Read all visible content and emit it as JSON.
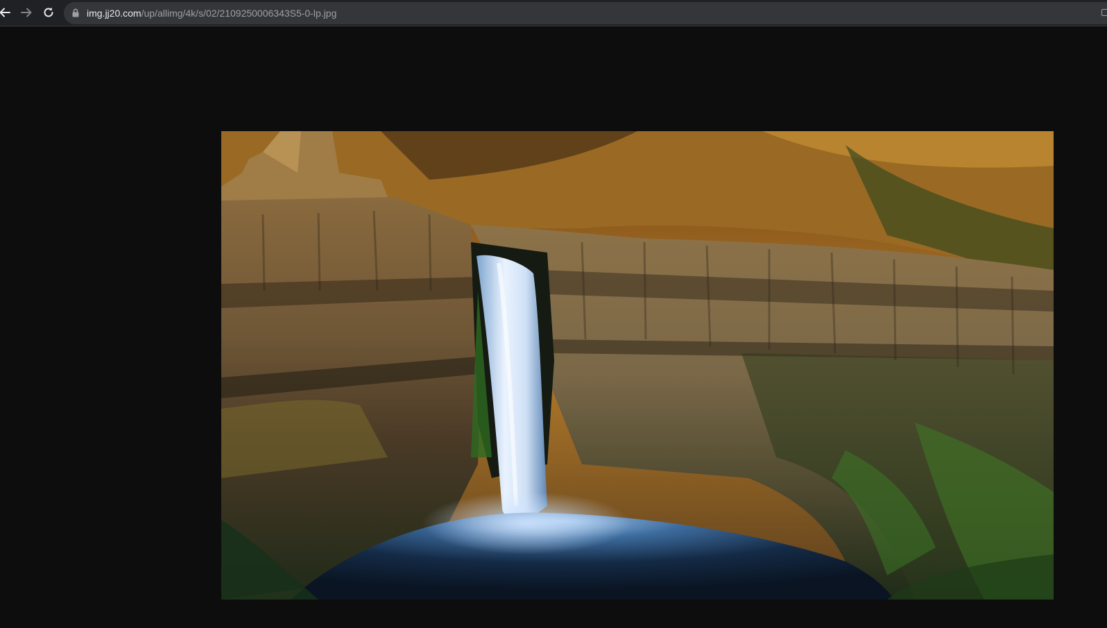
{
  "browser": {
    "back_icon": "arrow-left-icon",
    "forward_icon": "arrow-right-icon",
    "reload_icon": "reload-icon",
    "lock_icon": "lock-icon",
    "url_host": "img.jj20.com",
    "url_path": "/up/allimg/4k/s/02/2109250006343S5-0-lp.jpg"
  },
  "content": {
    "image_kind": "photo-waterfall-canyon"
  }
}
